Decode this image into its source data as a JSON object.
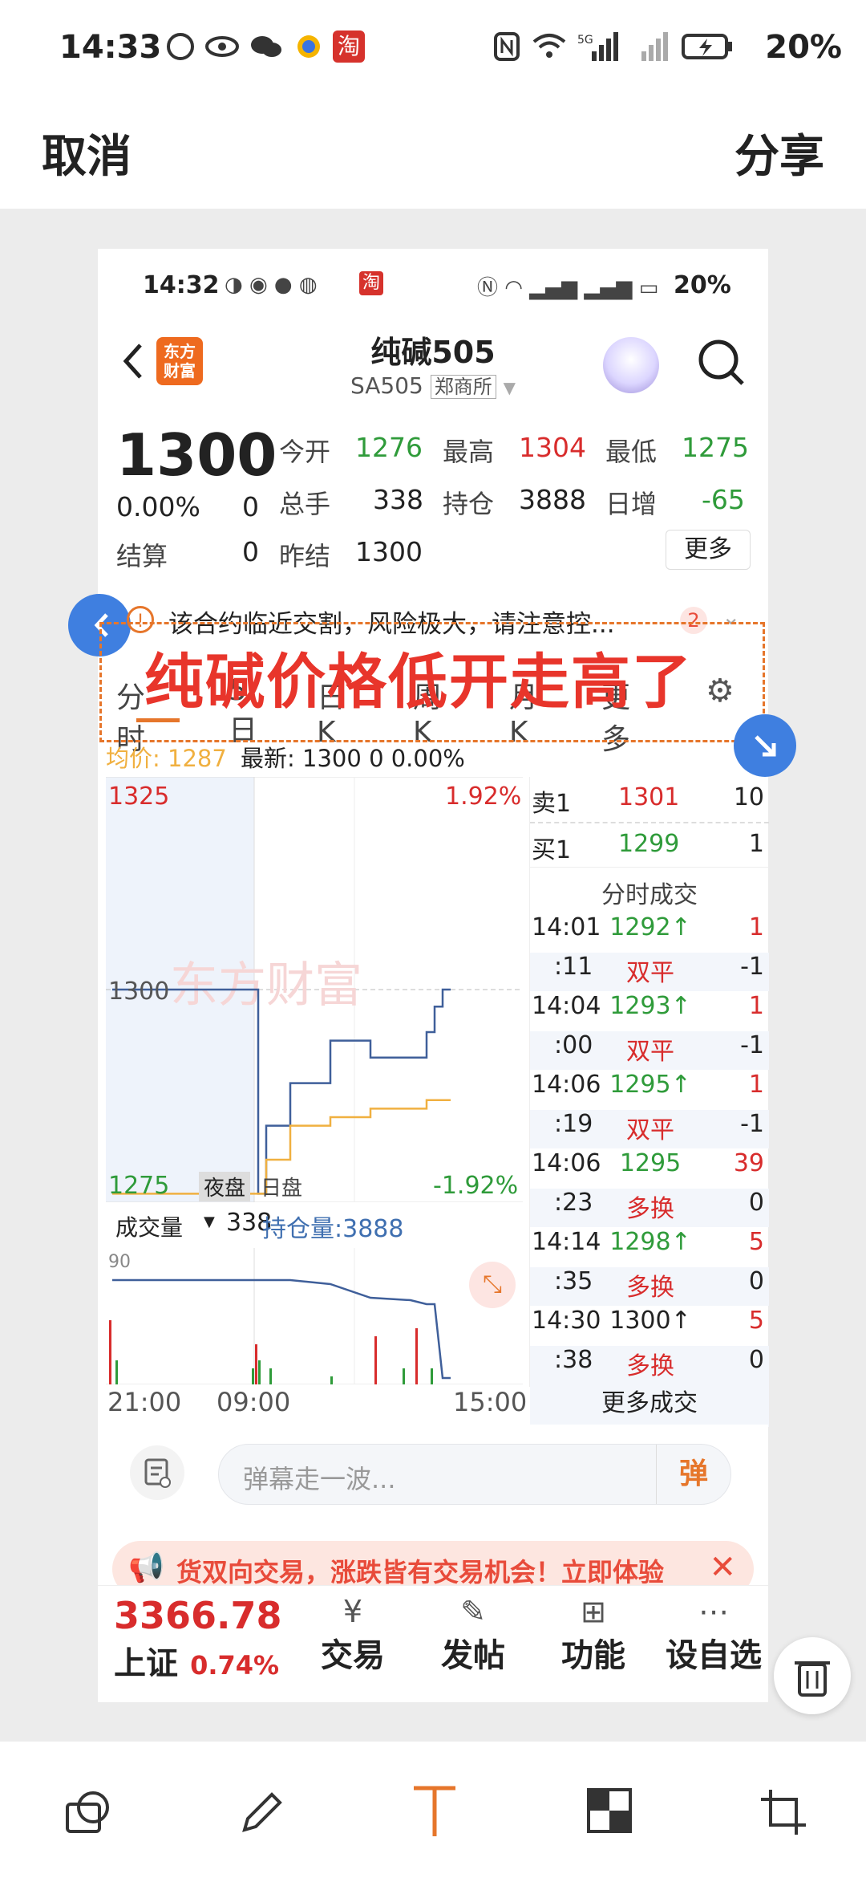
{
  "status_bar": {
    "time": "14:33",
    "battery": "20%"
  },
  "top_bar": {
    "cancel": "取消",
    "share": "分享"
  },
  "inner_status": {
    "time": "14:32",
    "battery": "20%"
  },
  "header": {
    "logo": "东方\n财富",
    "title": "纯碱505",
    "code": "SA505",
    "exchange": "郑商所"
  },
  "quote": {
    "price": "1300",
    "change_pct": "0.00%",
    "change": "0",
    "settle_label": "结算",
    "settle": "0",
    "open_label": "今开",
    "open": "1276",
    "high_label": "最高",
    "high": "1304",
    "low_label": "最低",
    "low": "1275",
    "vol_label": "总手",
    "vol": "338",
    "oi_label": "持仓",
    "oi": "3888",
    "oichg_label": "日增",
    "oichg": "-65",
    "prev_label": "昨结",
    "prev": "1300",
    "more": "更多"
  },
  "warning": {
    "text": "该合约临近交割，风险极大，请注意控...",
    "count": "2"
  },
  "overlay_text": "纯碱价格低开走高了",
  "tabs": [
    "分时",
    "5日",
    "日K",
    "周K",
    "月K",
    "更多"
  ],
  "avg_line": {
    "avg_label": "均价:",
    "avg": "1287",
    "last_label": "最新:",
    "last": "1300",
    "chg": "0",
    "pct": "0.00%"
  },
  "chart": {
    "y_top": "1325",
    "y_mid": "1300",
    "y_bot": "1275",
    "pct_top": "1.92%",
    "pct_bot": "-1.92%",
    "session_night": "夜盘",
    "session_day": "日盘",
    "vol_label": "成交量",
    "vol_val": "338",
    "oi_label": "持仓量:3888",
    "vol_max": "90",
    "x_labels": [
      "21:00",
      "09:00",
      "15:00"
    ],
    "watermark": "东方财富"
  },
  "chart_data": {
    "type": "line",
    "x": [
      "21:00",
      "09:00",
      "09:30",
      "10:00",
      "11:00",
      "13:30",
      "14:00",
      "14:10",
      "14:20",
      "14:30",
      "15:00"
    ],
    "series": [
      {
        "name": "最新",
        "values": [
          1300,
          1276,
          1284,
          1289,
          1294,
          1292,
          1292,
          1295,
          1298,
          1300,
          1300
        ]
      },
      {
        "name": "均价",
        "values": [
          1276,
          1276,
          1280,
          1284,
          1285,
          1286,
          1286,
          1287,
          1287,
          1287,
          1287
        ]
      }
    ],
    "ylim": [
      1275,
      1325
    ]
  },
  "order_book": [
    {
      "label": "卖1",
      "price": "1301",
      "qty": "10"
    },
    {
      "label": "买1",
      "price": "1299",
      "qty": "1"
    }
  ],
  "trades_title": "分时成交",
  "trades": [
    {
      "t": "14:01",
      "p": "1292↑",
      "q": "1",
      "pc": "green",
      "qc": "red"
    },
    {
      "t": ":11",
      "p": "双平",
      "q": "-1",
      "pc": "red",
      "qc": "black"
    },
    {
      "t": "14:04",
      "p": "1293↑",
      "q": "1",
      "pc": "green",
      "qc": "red"
    },
    {
      "t": ":00",
      "p": "双平",
      "q": "-1",
      "pc": "red",
      "qc": "black"
    },
    {
      "t": "14:06",
      "p": "1295↑",
      "q": "1",
      "pc": "green",
      "qc": "red"
    },
    {
      "t": ":19",
      "p": "双平",
      "q": "-1",
      "pc": "red",
      "qc": "black"
    },
    {
      "t": "14:06",
      "p": "1295",
      "q": "39",
      "pc": "green",
      "qc": "red"
    },
    {
      "t": ":23",
      "p": "多换",
      "q": "0",
      "pc": "red",
      "qc": "black"
    },
    {
      "t": "14:14",
      "p": "1298↑",
      "q": "5",
      "pc": "green",
      "qc": "red"
    },
    {
      "t": ":35",
      "p": "多换",
      "q": "0",
      "pc": "red",
      "qc": "black"
    },
    {
      "t": "14:30",
      "p": "1300↑",
      "q": "5",
      "pc": "black",
      "qc": "red"
    },
    {
      "t": ":38",
      "p": "多换",
      "q": "0",
      "pc": "red",
      "qc": "black"
    }
  ],
  "more_trades": "更多成交",
  "comment_placeholder": "弹幕走一波...",
  "danmu_btn": "弹",
  "promo": "货双向交易，涨跌皆有交易机会！立即体验",
  "index": {
    "value": "3366.78",
    "name": "上证",
    "pct": "0.74%"
  },
  "nav": [
    "交易",
    "发帖",
    "功能",
    "设自选"
  ]
}
